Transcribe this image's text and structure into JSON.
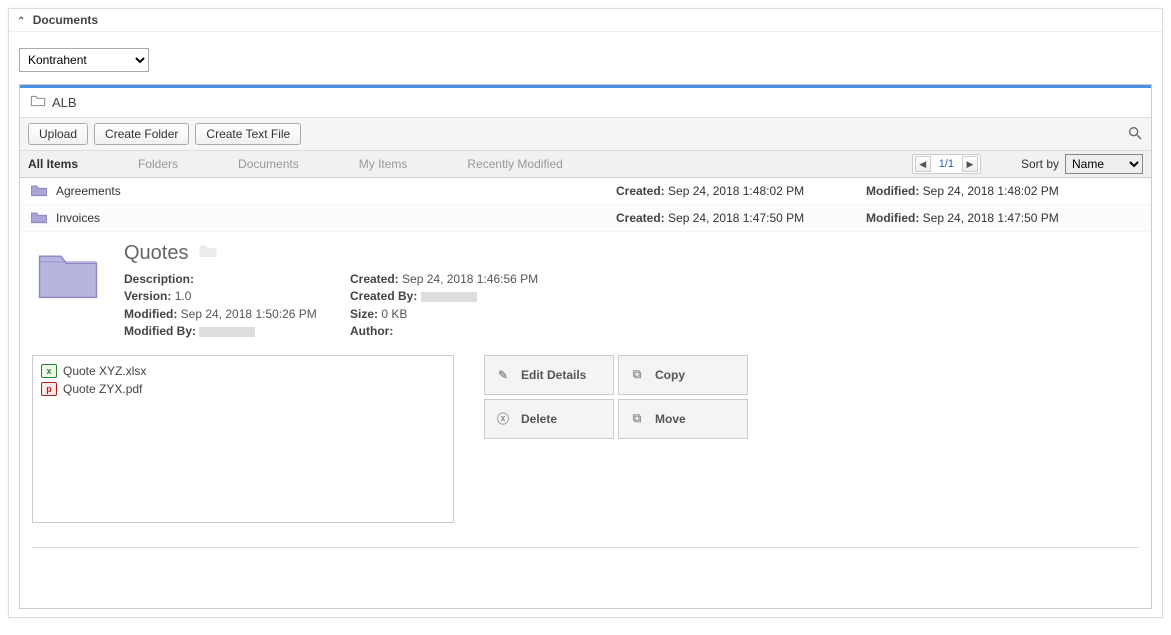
{
  "header": {
    "title": "Documents"
  },
  "select": {
    "value": "Kontrahent"
  },
  "breadcrumb": {
    "location": "ALB"
  },
  "toolbar": {
    "upload": "Upload",
    "create_folder": "Create Folder",
    "create_text_file": "Create Text File"
  },
  "tabs": {
    "all_items": "All Items",
    "folders": "Folders",
    "documents": "Documents",
    "my_items": "My Items",
    "recently_modified": "Recently Modified"
  },
  "pager": {
    "text": "1/1"
  },
  "sort": {
    "label": "Sort by",
    "value": "Name"
  },
  "rows": [
    {
      "name": "Agreements",
      "created_label": "Created:",
      "created": "Sep 24, 2018 1:48:02 PM",
      "modified_label": "Modified:",
      "modified": "Sep 24, 2018 1:48:02 PM"
    },
    {
      "name": "Invoices",
      "created_label": "Created:",
      "created": "Sep 24, 2018 1:47:50 PM",
      "modified_label": "Modified:",
      "modified": "Sep 24, 2018 1:47:50 PM"
    }
  ],
  "detail": {
    "title": "Quotes",
    "description_label": "Description:",
    "version_label": "Version:",
    "version_value": "1.0",
    "modified_label": "Modified:",
    "modified_value": "Sep 24, 2018 1:50:26 PM",
    "modified_by_label": "Modified By:",
    "created_label": "Created:",
    "created_value": "Sep 24, 2018 1:46:56 PM",
    "created_by_label": "Created By:",
    "size_label": "Size:",
    "size_value": "0 KB",
    "author_label": "Author:"
  },
  "files": [
    {
      "name": "Quote XYZ.xlsx",
      "type": "xlsx"
    },
    {
      "name": "Quote ZYX.pdf",
      "type": "pdf"
    }
  ],
  "actions": {
    "edit_details": "Edit Details",
    "copy": "Copy",
    "delete": "Delete",
    "move": "Move"
  }
}
